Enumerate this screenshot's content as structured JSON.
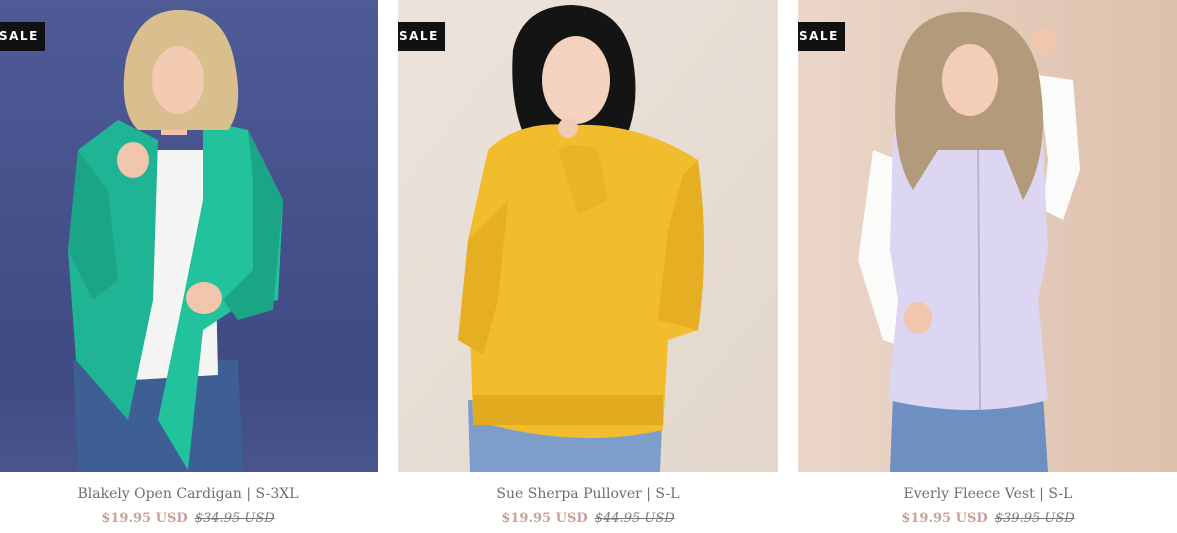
{
  "products": [
    {
      "badge": "SALE",
      "title": "Blakely Open Cardigan | S-3XL",
      "sale_price": "$19.95 USD",
      "original_price": "$34.95 USD",
      "colors": {
        "background": "#4a5590",
        "garment": "#1fb493"
      }
    },
    {
      "badge": "SALE",
      "title": "Sue Sherpa Pullover | S-L",
      "sale_price": "$19.95 USD",
      "original_price": "$44.95 USD",
      "colors": {
        "background": "#e7ddd3",
        "garment": "#f1bd2c"
      }
    },
    {
      "badge": "SALE",
      "title": "Everly Fleece Vest | S-L",
      "sale_price": "$19.95 USD",
      "original_price": "$39.95 USD",
      "colors": {
        "background": "#e3c9b8",
        "garment": "#ddd6f3"
      }
    }
  ],
  "colors": {
    "sale_price": "#c9a09a",
    "title_text": "#6e6e6e",
    "badge_bg": "#111111"
  }
}
